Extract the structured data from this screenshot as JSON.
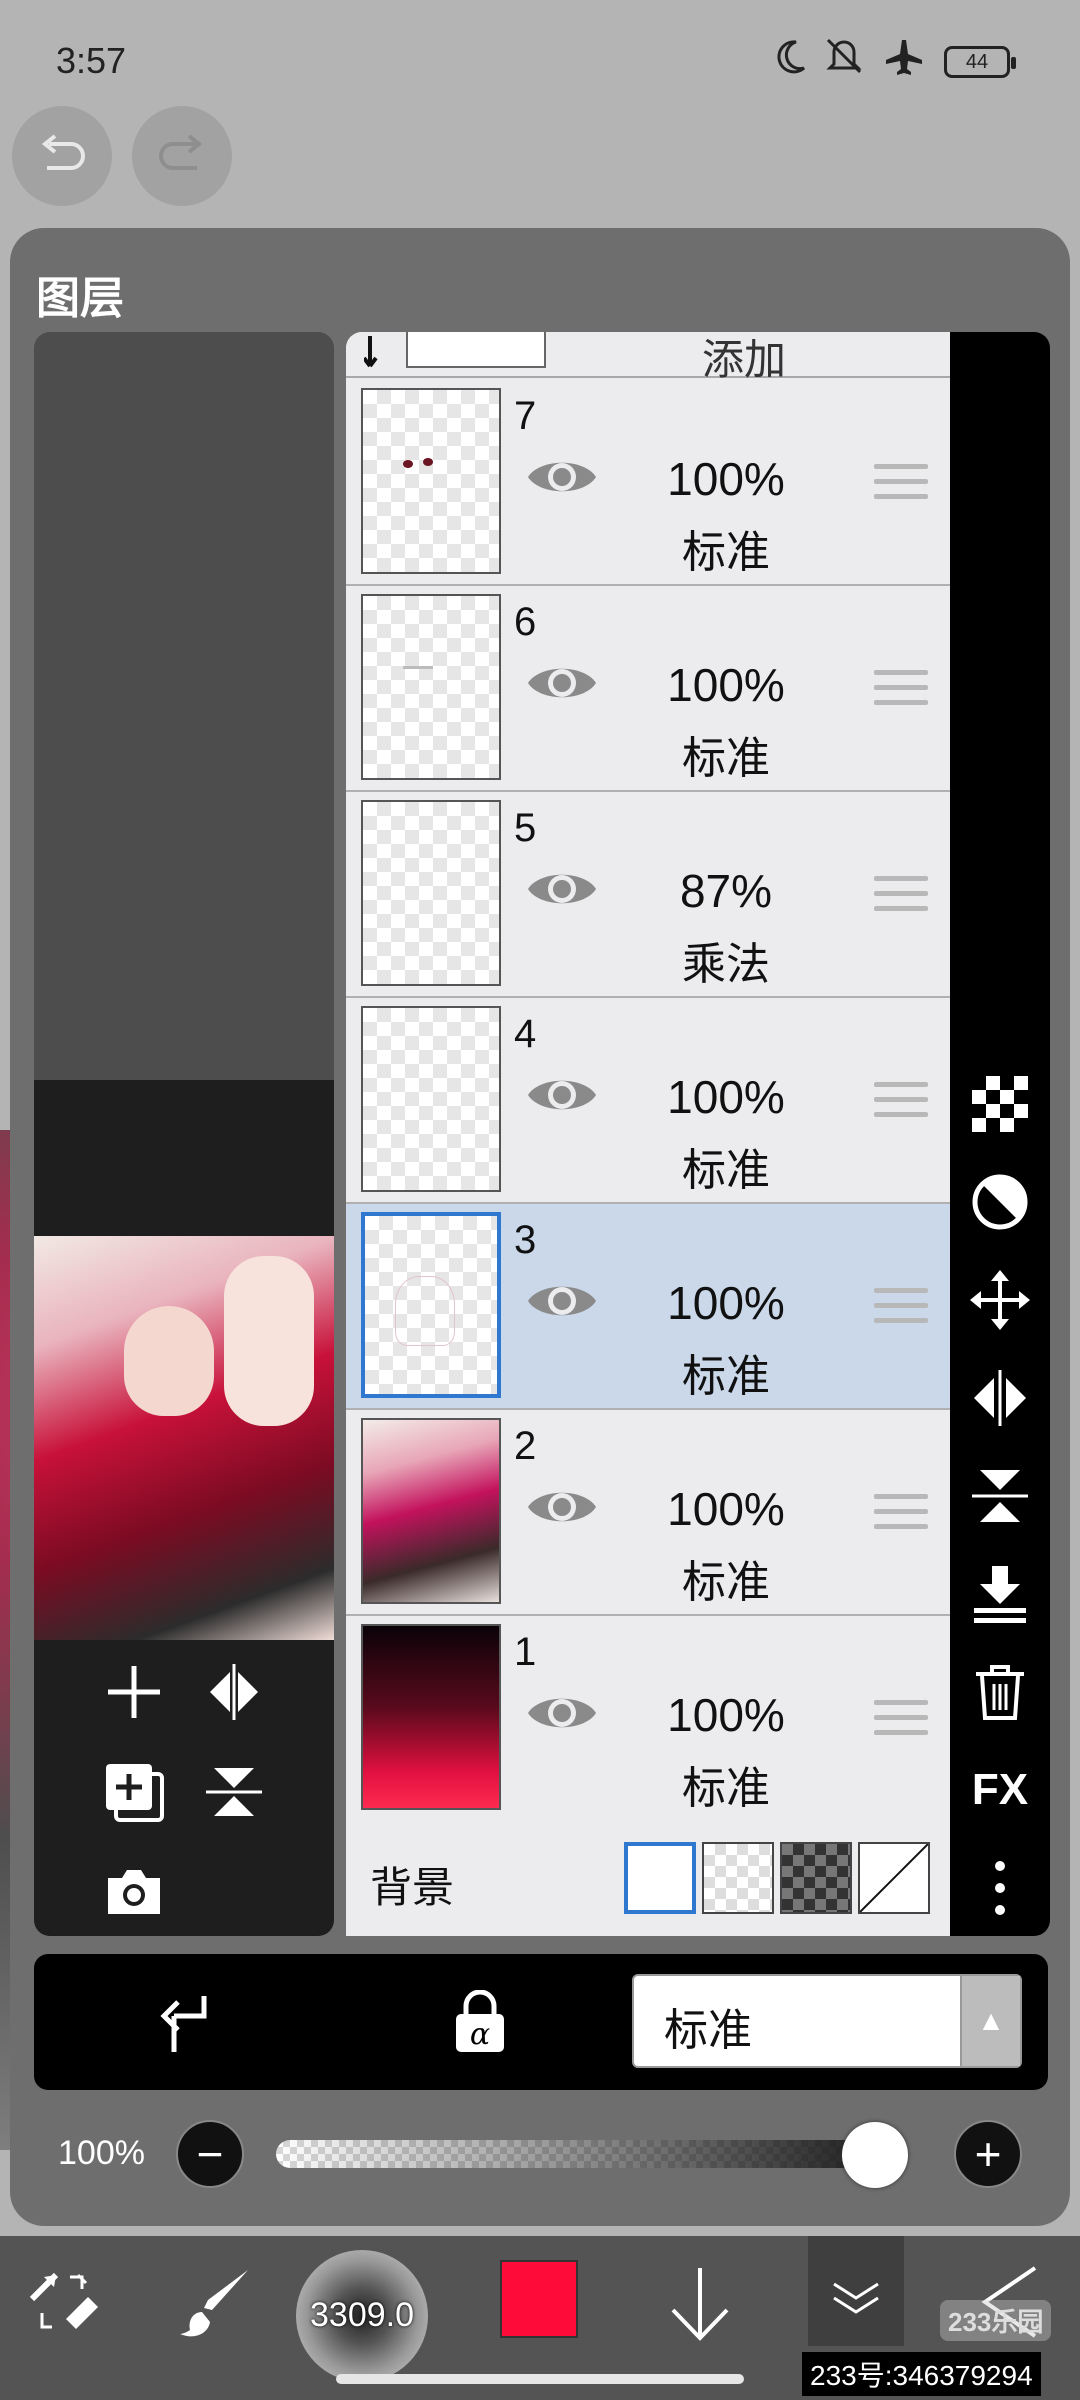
{
  "status_bar": {
    "time": "3:57",
    "battery": "44",
    "icons": [
      "moon-icon",
      "mute-icon",
      "airplane-icon",
      "battery-icon"
    ]
  },
  "top_buttons": {
    "icons": [
      "undo-icon",
      "redo-icon"
    ]
  },
  "panel": {
    "title": "图层"
  },
  "layers": {
    "partial_top_blend": "添加",
    "rows": [
      {
        "number": "7",
        "opacity": "100%",
        "blend": "标准",
        "selected": false
      },
      {
        "number": "6",
        "opacity": "100%",
        "blend": "标准",
        "selected": false
      },
      {
        "number": "5",
        "opacity": "87%",
        "blend": "乘法",
        "selected": false
      },
      {
        "number": "4",
        "opacity": "100%",
        "blend": "标准",
        "selected": false
      },
      {
        "number": "3",
        "opacity": "100%",
        "blend": "标准",
        "selected": true
      },
      {
        "number": "2",
        "opacity": "100%",
        "blend": "标准",
        "selected": false
      },
      {
        "number": "1",
        "opacity": "100%",
        "blend": "标准",
        "selected": false
      }
    ]
  },
  "background": {
    "label": "背景",
    "options": [
      "white",
      "transparent-light",
      "transparent-dark",
      "none"
    ],
    "selected": "white"
  },
  "right_tools": {
    "fx_label": "FX",
    "icons": [
      "checker-icon",
      "contrast-icon",
      "move-icon",
      "flip-horizontal-icon",
      "flip-vertical-icon",
      "merge-down-icon",
      "trash-icon",
      "fx-icon",
      "more-icon"
    ]
  },
  "left_tools": {
    "icons": [
      "add-layer-icon",
      "flip-horizontal-icon",
      "duplicate-layer-icon",
      "flip-vertical-icon",
      "camera-icon"
    ]
  },
  "action_bar": {
    "blend_mode": "标准",
    "icons": [
      "clip-icon",
      "alpha-lock-icon",
      "dropdown-arrow-icon"
    ]
  },
  "opacity": {
    "label": "100%",
    "value": 1.0
  },
  "toolbar": {
    "brush_size": "3309.0",
    "color": "#ff0b3a",
    "icons": [
      "transform-icon",
      "brush-icon",
      "color-swatch",
      "download-icon",
      "collapse-icon",
      "back-icon"
    ]
  },
  "watermark": {
    "logo": "233乐园",
    "id": "233号:346379294"
  }
}
